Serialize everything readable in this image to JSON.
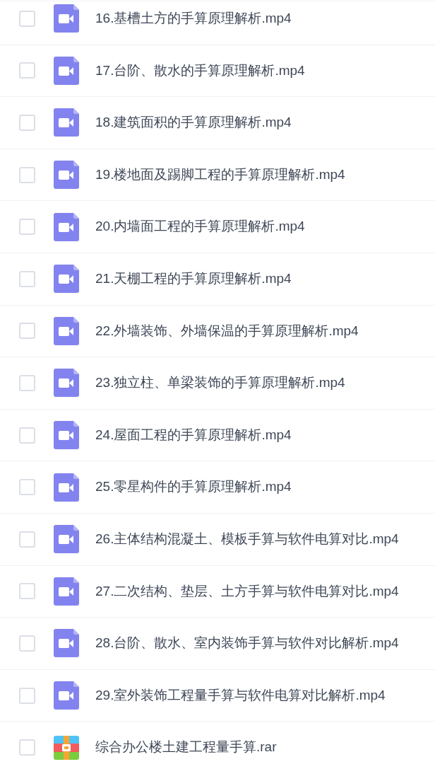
{
  "files": [
    {
      "name": "16.基槽土方的手算原理解析.mp4",
      "kind": "video",
      "checked": false
    },
    {
      "name": "17.台阶、散水的手算原理解析.mp4",
      "kind": "video",
      "checked": false
    },
    {
      "name": "18.建筑面积的手算原理解析.mp4",
      "kind": "video",
      "checked": false
    },
    {
      "name": "19.楼地面及踢脚工程的手算原理解析.mp4",
      "kind": "video",
      "checked": false
    },
    {
      "name": "20.内墙面工程的手算原理解析.mp4",
      "kind": "video",
      "checked": false
    },
    {
      "name": "21.天棚工程的手算原理解析.mp4",
      "kind": "video",
      "checked": false
    },
    {
      "name": "22.外墙装饰、外墙保温的手算原理解析.mp4",
      "kind": "video",
      "checked": false
    },
    {
      "name": "23.独立柱、单梁装饰的手算原理解析.mp4",
      "kind": "video",
      "checked": false
    },
    {
      "name": "24.屋面工程的手算原理解析.mp4",
      "kind": "video",
      "checked": false
    },
    {
      "name": "25.零星构件的手算原理解析.mp4",
      "kind": "video",
      "checked": false
    },
    {
      "name": "26.主体结构混凝土、模板手算与软件电算对比.mp4",
      "kind": "video",
      "checked": false
    },
    {
      "name": "27.二次结构、垫层、土方手算与软件电算对比.mp4",
      "kind": "video",
      "checked": false
    },
    {
      "name": "28.台阶、散水、室内装饰手算与软件对比解析.mp4",
      "kind": "video",
      "checked": false
    },
    {
      "name": "29.室外装饰工程量手算与软件电算对比解析.mp4",
      "kind": "video",
      "checked": false
    },
    {
      "name": "综合办公楼土建工程量手算.rar",
      "kind": "archive",
      "checked": false
    }
  ]
}
